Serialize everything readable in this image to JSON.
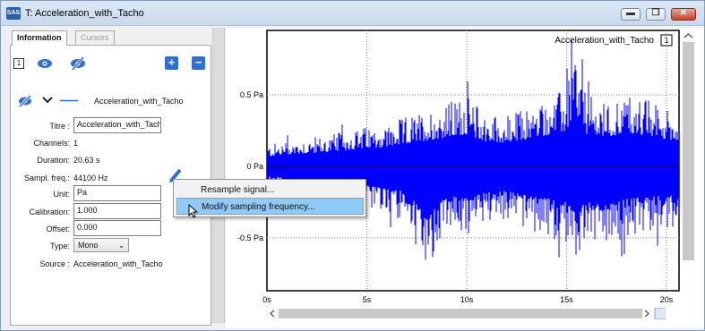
{
  "window": {
    "app_icon_text": "SAS",
    "title": "T: Acceleration_with_Tacho",
    "buttons": {
      "minimize": "▬",
      "restore": "❐",
      "close": "✕"
    }
  },
  "tabs": [
    {
      "label": "Information",
      "active": true
    },
    {
      "label": "Cursors",
      "active": false
    }
  ],
  "toolbar": {
    "channel_badge": "1",
    "eye_icon": "eye-icon",
    "eye_off_icon": "eye-off-icon",
    "add_icon": "plus-icon",
    "remove_icon": "minus-icon"
  },
  "signal": {
    "name": "Acceleration_with_Tacho",
    "line_color": "#0000ff"
  },
  "fields": {
    "titre_label": "Titre :",
    "titre_value": "Acceleration_with_Tacho",
    "channels_label": "Channels:",
    "channels_value": "1",
    "duration_label": "Duration:",
    "duration_value": "20.63  s",
    "sampl_label": "Sampl. freq.:",
    "sampl_value": "44100  Hz",
    "unit_label": "Unit:",
    "unit_value": "Pa",
    "calibration_label": "Calibration:",
    "calibration_value": "1.000",
    "offset_label": "Offset:",
    "offset_value": "0.000",
    "type_label": "Type:",
    "type_value": "Mono",
    "source_label": "Source :",
    "source_value": "Acceleration_with_Tacho"
  },
  "context_menu": {
    "items": [
      {
        "label": "Resample signal...",
        "highlighted": false
      },
      {
        "label": "Modify sampling frequency...",
        "highlighted": true
      }
    ]
  },
  "chart_data": {
    "type": "line",
    "title": "Acceleration_with_Tacho",
    "legend_badge": "1",
    "xlabel": "",
    "ylabel": "",
    "x_ticks": [
      "0s",
      "5s",
      "10s",
      "15s",
      "20s"
    ],
    "y_ticks": [
      "0.5 Pa",
      "0 Pa",
      "-0.5 Pa"
    ],
    "xlim": [
      0,
      20.63
    ],
    "ylim": [
      -0.87,
      0.95
    ],
    "grid": true,
    "series": [
      {
        "color": "#0000ff",
        "envelope_note": "dense waveform"
      }
    ],
    "envelope": {
      "x": [
        0,
        1,
        2,
        3,
        4,
        5,
        6,
        7,
        8,
        9,
        10,
        11,
        12,
        13,
        14,
        15,
        15.4,
        16,
        17,
        18,
        19,
        20,
        20.63
      ],
      "upper": [
        0.15,
        0.18,
        0.2,
        0.22,
        0.25,
        0.28,
        0.3,
        0.35,
        0.4,
        0.45,
        0.5,
        0.38,
        0.36,
        0.42,
        0.48,
        0.55,
        0.85,
        0.5,
        0.45,
        0.52,
        0.48,
        0.42,
        0.4
      ],
      "lower": [
        -0.15,
        -0.18,
        -0.22,
        -0.25,
        -0.28,
        -0.3,
        -0.35,
        -0.38,
        -0.8,
        -0.45,
        -0.5,
        -0.4,
        -0.38,
        -0.45,
        -0.5,
        -0.55,
        -0.72,
        -0.55,
        -0.6,
        -0.5,
        -0.48,
        -0.45,
        -0.45
      ]
    }
  }
}
